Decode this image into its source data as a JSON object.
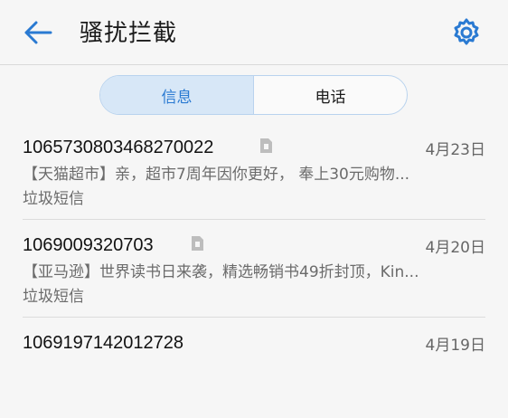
{
  "header": {
    "title": "骚扰拦截",
    "back_icon": "arrow-left-icon",
    "settings_icon": "gear-icon",
    "accent": "#2a7ad2"
  },
  "tabs": [
    {
      "label": "信息",
      "active": true
    },
    {
      "label": "电话",
      "active": false
    }
  ],
  "messages": [
    {
      "sender": "1065730803468270022",
      "date": "4月23日",
      "preview": "【天猫超市】亲，超市7周年因你更好， 奉上30元购物...",
      "category": "垃圾短信"
    },
    {
      "sender": "1069009320703",
      "date": "4月20日",
      "preview": "【亚马逊】世界读书日来袭，精选畅销书49折封顶，Kin...",
      "category": "垃圾短信"
    },
    {
      "sender": "1069197142012728",
      "date": "4月19日",
      "preview": "",
      "category": ""
    }
  ]
}
